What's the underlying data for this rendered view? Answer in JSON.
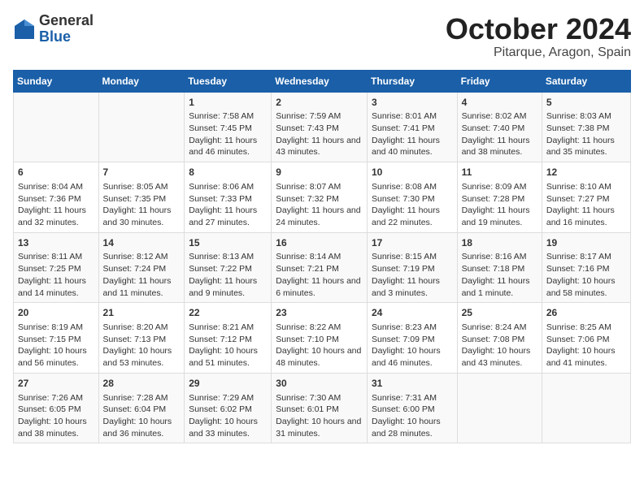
{
  "logo": {
    "general": "General",
    "blue": "Blue"
  },
  "header": {
    "month": "October 2024",
    "location": "Pitarque, Aragon, Spain"
  },
  "weekdays": [
    "Sunday",
    "Monday",
    "Tuesday",
    "Wednesday",
    "Thursday",
    "Friday",
    "Saturday"
  ],
  "weeks": [
    [
      {
        "day": "",
        "sunrise": "",
        "sunset": "",
        "daylight": ""
      },
      {
        "day": "",
        "sunrise": "",
        "sunset": "",
        "daylight": ""
      },
      {
        "day": "1",
        "sunrise": "Sunrise: 7:58 AM",
        "sunset": "Sunset: 7:45 PM",
        "daylight": "Daylight: 11 hours and 46 minutes."
      },
      {
        "day": "2",
        "sunrise": "Sunrise: 7:59 AM",
        "sunset": "Sunset: 7:43 PM",
        "daylight": "Daylight: 11 hours and 43 minutes."
      },
      {
        "day": "3",
        "sunrise": "Sunrise: 8:01 AM",
        "sunset": "Sunset: 7:41 PM",
        "daylight": "Daylight: 11 hours and 40 minutes."
      },
      {
        "day": "4",
        "sunrise": "Sunrise: 8:02 AM",
        "sunset": "Sunset: 7:40 PM",
        "daylight": "Daylight: 11 hours and 38 minutes."
      },
      {
        "day": "5",
        "sunrise": "Sunrise: 8:03 AM",
        "sunset": "Sunset: 7:38 PM",
        "daylight": "Daylight: 11 hours and 35 minutes."
      }
    ],
    [
      {
        "day": "6",
        "sunrise": "Sunrise: 8:04 AM",
        "sunset": "Sunset: 7:36 PM",
        "daylight": "Daylight: 11 hours and 32 minutes."
      },
      {
        "day": "7",
        "sunrise": "Sunrise: 8:05 AM",
        "sunset": "Sunset: 7:35 PM",
        "daylight": "Daylight: 11 hours and 30 minutes."
      },
      {
        "day": "8",
        "sunrise": "Sunrise: 8:06 AM",
        "sunset": "Sunset: 7:33 PM",
        "daylight": "Daylight: 11 hours and 27 minutes."
      },
      {
        "day": "9",
        "sunrise": "Sunrise: 8:07 AM",
        "sunset": "Sunset: 7:32 PM",
        "daylight": "Daylight: 11 hours and 24 minutes."
      },
      {
        "day": "10",
        "sunrise": "Sunrise: 8:08 AM",
        "sunset": "Sunset: 7:30 PM",
        "daylight": "Daylight: 11 hours and 22 minutes."
      },
      {
        "day": "11",
        "sunrise": "Sunrise: 8:09 AM",
        "sunset": "Sunset: 7:28 PM",
        "daylight": "Daylight: 11 hours and 19 minutes."
      },
      {
        "day": "12",
        "sunrise": "Sunrise: 8:10 AM",
        "sunset": "Sunset: 7:27 PM",
        "daylight": "Daylight: 11 hours and 16 minutes."
      }
    ],
    [
      {
        "day": "13",
        "sunrise": "Sunrise: 8:11 AM",
        "sunset": "Sunset: 7:25 PM",
        "daylight": "Daylight: 11 hours and 14 minutes."
      },
      {
        "day": "14",
        "sunrise": "Sunrise: 8:12 AM",
        "sunset": "Sunset: 7:24 PM",
        "daylight": "Daylight: 11 hours and 11 minutes."
      },
      {
        "day": "15",
        "sunrise": "Sunrise: 8:13 AM",
        "sunset": "Sunset: 7:22 PM",
        "daylight": "Daylight: 11 hours and 9 minutes."
      },
      {
        "day": "16",
        "sunrise": "Sunrise: 8:14 AM",
        "sunset": "Sunset: 7:21 PM",
        "daylight": "Daylight: 11 hours and 6 minutes."
      },
      {
        "day": "17",
        "sunrise": "Sunrise: 8:15 AM",
        "sunset": "Sunset: 7:19 PM",
        "daylight": "Daylight: 11 hours and 3 minutes."
      },
      {
        "day": "18",
        "sunrise": "Sunrise: 8:16 AM",
        "sunset": "Sunset: 7:18 PM",
        "daylight": "Daylight: 11 hours and 1 minute."
      },
      {
        "day": "19",
        "sunrise": "Sunrise: 8:17 AM",
        "sunset": "Sunset: 7:16 PM",
        "daylight": "Daylight: 10 hours and 58 minutes."
      }
    ],
    [
      {
        "day": "20",
        "sunrise": "Sunrise: 8:19 AM",
        "sunset": "Sunset: 7:15 PM",
        "daylight": "Daylight: 10 hours and 56 minutes."
      },
      {
        "day": "21",
        "sunrise": "Sunrise: 8:20 AM",
        "sunset": "Sunset: 7:13 PM",
        "daylight": "Daylight: 10 hours and 53 minutes."
      },
      {
        "day": "22",
        "sunrise": "Sunrise: 8:21 AM",
        "sunset": "Sunset: 7:12 PM",
        "daylight": "Daylight: 10 hours and 51 minutes."
      },
      {
        "day": "23",
        "sunrise": "Sunrise: 8:22 AM",
        "sunset": "Sunset: 7:10 PM",
        "daylight": "Daylight: 10 hours and 48 minutes."
      },
      {
        "day": "24",
        "sunrise": "Sunrise: 8:23 AM",
        "sunset": "Sunset: 7:09 PM",
        "daylight": "Daylight: 10 hours and 46 minutes."
      },
      {
        "day": "25",
        "sunrise": "Sunrise: 8:24 AM",
        "sunset": "Sunset: 7:08 PM",
        "daylight": "Daylight: 10 hours and 43 minutes."
      },
      {
        "day": "26",
        "sunrise": "Sunrise: 8:25 AM",
        "sunset": "Sunset: 7:06 PM",
        "daylight": "Daylight: 10 hours and 41 minutes."
      }
    ],
    [
      {
        "day": "27",
        "sunrise": "Sunrise: 7:26 AM",
        "sunset": "Sunset: 6:05 PM",
        "daylight": "Daylight: 10 hours and 38 minutes."
      },
      {
        "day": "28",
        "sunrise": "Sunrise: 7:28 AM",
        "sunset": "Sunset: 6:04 PM",
        "daylight": "Daylight: 10 hours and 36 minutes."
      },
      {
        "day": "29",
        "sunrise": "Sunrise: 7:29 AM",
        "sunset": "Sunset: 6:02 PM",
        "daylight": "Daylight: 10 hours and 33 minutes."
      },
      {
        "day": "30",
        "sunrise": "Sunrise: 7:30 AM",
        "sunset": "Sunset: 6:01 PM",
        "daylight": "Daylight: 10 hours and 31 minutes."
      },
      {
        "day": "31",
        "sunrise": "Sunrise: 7:31 AM",
        "sunset": "Sunset: 6:00 PM",
        "daylight": "Daylight: 10 hours and 28 minutes."
      },
      {
        "day": "",
        "sunrise": "",
        "sunset": "",
        "daylight": ""
      },
      {
        "day": "",
        "sunrise": "",
        "sunset": "",
        "daylight": ""
      }
    ]
  ]
}
